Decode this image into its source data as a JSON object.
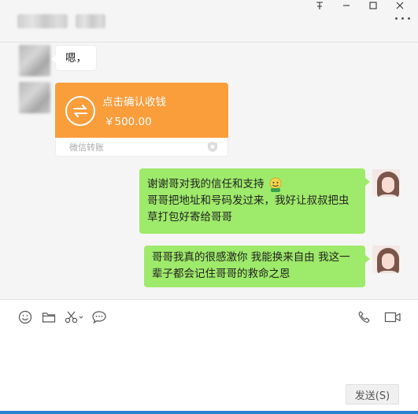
{
  "window": {
    "controls": {
      "pin": "⸸",
      "minimize": "—",
      "maximize": "□",
      "close": "✕"
    }
  },
  "messages": [
    {
      "direction": "in",
      "type": "text",
      "text": "嗯，"
    },
    {
      "direction": "in",
      "type": "transfer",
      "title": "点击确认收钱",
      "amount": "￥500.00",
      "label": "微信转账"
    },
    {
      "direction": "out",
      "type": "text",
      "lines": [
        "谢谢哥对我的信任和支持",
        "哥哥把地址和号码发过来，我好让叔叔把虫",
        "草打包好寄给哥哥"
      ],
      "emoji": "smile-emoji-icon"
    },
    {
      "direction": "out",
      "type": "text",
      "lines": [
        "哥哥我真的很感激你 我能换来自由 我这一",
        "辈子都会记住哥哥的救命之恩"
      ]
    }
  ],
  "toolbar": {
    "left": [
      "emoji-icon",
      "folder-icon",
      "scissors-icon",
      "chat-history-icon"
    ],
    "right": [
      "phone-icon",
      "video-icon"
    ]
  },
  "send": {
    "label": "发送(S)"
  },
  "colors": {
    "bubble_out": "#9eea6a",
    "transfer": "#fa9d3b",
    "accent": "#2b7fd4"
  }
}
